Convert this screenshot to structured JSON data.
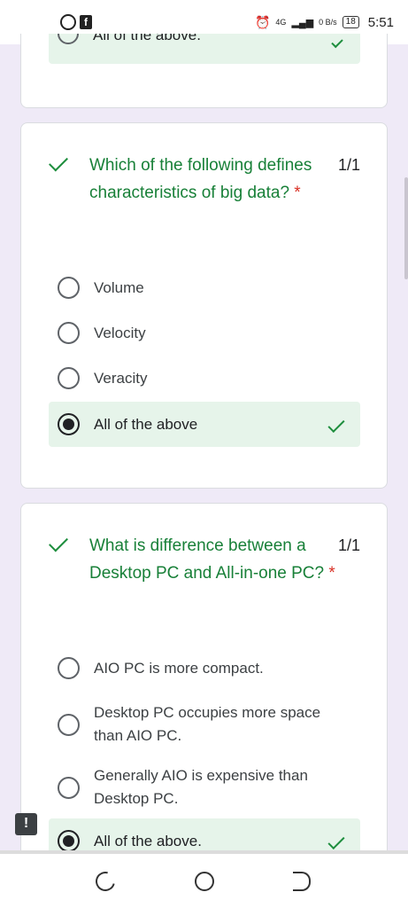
{
  "status_bar": {
    "left_icons": [
      "whatsapp-icon",
      "facebook-icon"
    ],
    "network": "4G",
    "data_speed": "0 B/s",
    "battery": "18",
    "time": "5:51"
  },
  "top_partial": {
    "option_label": "All of the above."
  },
  "questions": [
    {
      "text": "Which of the following defines characteristics of big data?",
      "required_mark": "*",
      "score": "1/1",
      "options": [
        {
          "label": "Volume",
          "selected": false
        },
        {
          "label": "Velocity",
          "selected": false
        },
        {
          "label": "Veracity",
          "selected": false
        },
        {
          "label": "All of the above",
          "selected": true,
          "correct": true
        }
      ]
    },
    {
      "text": "What is difference between a Desktop PC and All-in-one PC?",
      "required_mark": "*",
      "score": "1/1",
      "options": [
        {
          "label": "AIO PC is more compact.",
          "selected": false
        },
        {
          "label": "Desktop PC occupies more space than AIO PC.",
          "selected": false
        },
        {
          "label": "Generally AIO is expensive than Desktop PC.",
          "selected": false
        },
        {
          "label": "All of the above.",
          "selected": true,
          "correct": true
        }
      ]
    }
  ],
  "feedback_label": "!",
  "colors": {
    "accent_green": "#188038",
    "selected_bg": "#e6f4ea",
    "required_red": "#d93025",
    "page_bg": "#efeaf7"
  }
}
